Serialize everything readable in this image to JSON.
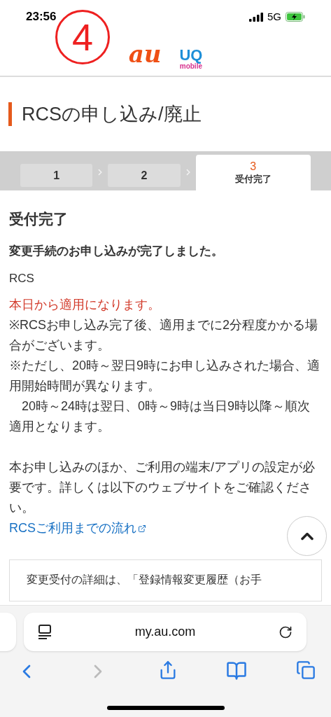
{
  "status_bar": {
    "time": "23:56",
    "network": "5G"
  },
  "annotation": {
    "label": "4"
  },
  "header": {
    "au_logo": "au",
    "uq_logo": "UQ",
    "uq_sub": "mobile"
  },
  "page_title": "RCSの申し込み/廃止",
  "steps": [
    {
      "number": "1",
      "selected": false
    },
    {
      "number": "2",
      "selected": false
    },
    {
      "number": "3",
      "label": "受付完了",
      "selected": true
    }
  ],
  "section_heading": "受付完了",
  "message": "変更手続のお申し込みが完了しました。",
  "service": "RCS",
  "paragraphs": [
    {
      "kind": "notice",
      "text": "本日から適用になります。"
    },
    {
      "kind": "note",
      "text": "※RCSお申し込み完了後、適用までに2分程度かかる場合がございます。"
    },
    {
      "kind": "note",
      "text": "※ただし、20時～翌日9時にお申し込みされた場合、適用開始時間が異なります。"
    },
    {
      "kind": "note",
      "text": "　20時～24時は翌日、0時～9時は当日9時以降～順次適用となります。"
    },
    {
      "kind": "info",
      "text": "本お申し込みのほか、ご利用の端末/アプリの設定が必要です。詳しくは以下のウェブサイトをご確認ください。"
    }
  ],
  "link": "RCSご利用までの流れ",
  "detail_card": "変更受付の詳細は、「登録情報変更履歴（お手",
  "browser": {
    "url": "my.au.com",
    "back_disabled": false,
    "forward_disabled": true
  }
}
